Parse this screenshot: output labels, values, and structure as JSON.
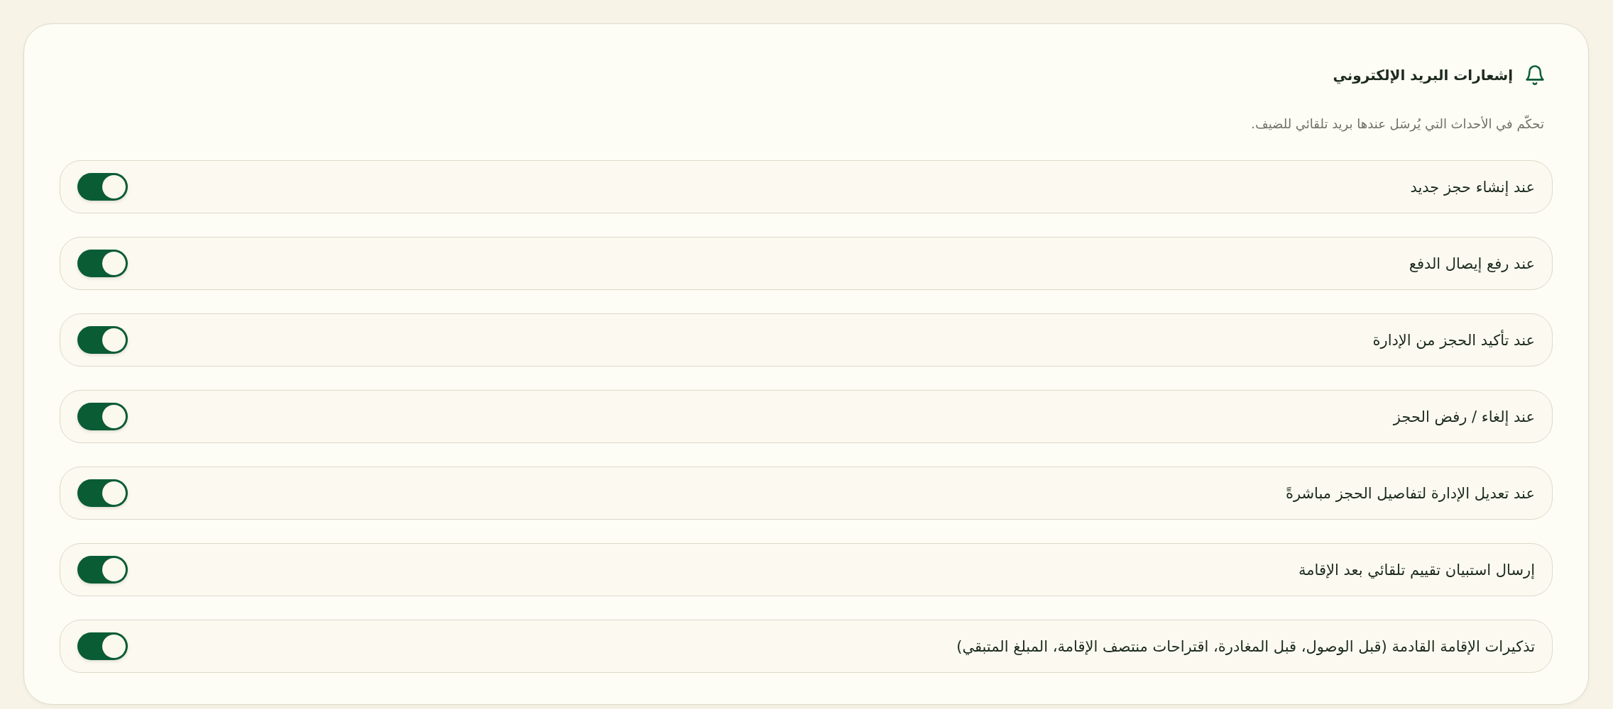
{
  "card": {
    "title": "إشعارات البريد الإلكتروني",
    "description": "تحكّم في الأحداث التي يُرسَل عندها بريد تلقائي للضيف."
  },
  "settings": [
    {
      "label": "عند إنشاء حجز جديد",
      "kind": "toggle",
      "on": true
    },
    {
      "label": "عند رفع إيصال الدفع",
      "kind": "toggle",
      "on": true
    },
    {
      "label": "عند تأكيد الحجز من الإدارة",
      "kind": "toggle",
      "on": true
    },
    {
      "label": "عند إلغاء / رفض الحجز",
      "kind": "toggle",
      "on": true
    },
    {
      "label": "عند تعديل الإدارة لتفاصيل الحجز مباشرةً",
      "kind": "toggle",
      "on": true
    },
    {
      "label": "إرسال استبيان تقييم تلقائي بعد الإقامة",
      "kind": "toggle",
      "on": true
    },
    {
      "label": "تذكيرات الإقامة القادمة (قبل الوصول، قبل المغادرة، اقتراحات منتصف الإقامة، المبلغ المتبقي)",
      "kind": "toggle",
      "on": true
    }
  ]
}
